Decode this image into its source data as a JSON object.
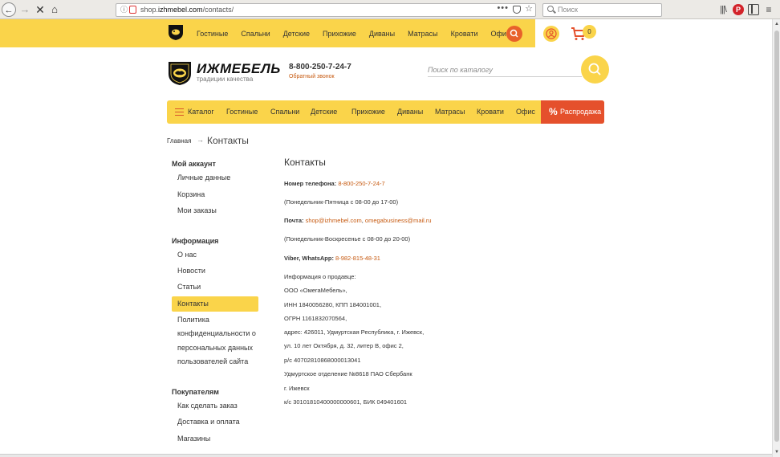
{
  "browser": {
    "url_prefix": "shop.",
    "url_domain": "izhmebel.com",
    "url_path": "/contacts/",
    "url_dots": "•••",
    "search_placeholder": "Поиск",
    "nav_back": "←",
    "nav_forward": "→",
    "nav_stop": "✕",
    "nav_home": "⌂",
    "info_glyph": "ⓘ",
    "star_glyph": "☆",
    "library_glyph": "|||\\",
    "pinterest_glyph": "P",
    "menu_glyph": "≡",
    "accent": "#e5502c"
  },
  "top_menu": [
    "Гостиные",
    "Спальни",
    "Детские",
    "Прихожие",
    "Диваны",
    "Матрасы",
    "Кровати",
    "Офис"
  ],
  "cart_count": "0",
  "brand": {
    "name": "ИЖМЕБЕЛЬ",
    "tagline": "традиции качества",
    "primary": "#fad44a"
  },
  "header": {
    "phone": "8-800-250-7-24-7",
    "callback": "Обратный звонок",
    "search_placeholder": "Поиск по каталогу"
  },
  "main_nav": {
    "catalog": "Каталог",
    "items": [
      "Гостиные",
      "Спальни",
      "Детские",
      "Прихожие",
      "Диваны",
      "Матрасы",
      "Кровати",
      "Офис"
    ],
    "sale_symbol": "%",
    "sale": "Распродажа"
  },
  "breadcrumb": {
    "home": "Главная",
    "separator": "→",
    "current": "Контакты"
  },
  "sidebar": {
    "account_heading": "Мой аккаунт",
    "account_links": [
      "Личные данные",
      "Корзина",
      "Мои заказы"
    ],
    "info_heading": "Информация",
    "info_links": [
      "О нас",
      "Новости",
      "Статьи",
      "Контакты"
    ],
    "privacy_lines": [
      "Политика",
      "конфиденциальности о",
      "персональных данных",
      "пользователей сайта"
    ],
    "buyers_heading": "Покупателям",
    "buyers_links": [
      "Как сделать заказ",
      "Доставка и оплата",
      "Магазины"
    ]
  },
  "content": {
    "title": "Контакты",
    "phone_label": "Номер телефона:",
    "phone_value": "8-800-250-7-24-7",
    "phone_hours": "(Понедельник-Пятница с 08-00 до 17-00)",
    "mail_label": "Почта:",
    "mail_1": "shop@izhmebel.com",
    "mail_sep": ",",
    "mail_2": "omegabusiness@mail.ru",
    "mail_hours": "(Понедельник-Воскресенье с 08-00 до 20-00)",
    "viber_label": "Viber, WhatsApp:",
    "viber_value": "8-982-815-48-31",
    "seller_lines": [
      "Информация о продавце:",
      "ООО «ОмегаМебель»,",
      "ИНН 1840056280, КПП 184001001,",
      "ОГРН 1161832070564,",
      "адрес: 426011, Удмуртская Республика, г. Ижевск,",
      "ул. 10 лет Октября, д. 32, литер В, офис 2,",
      "р/с 40702810868000013041",
      "Удмуртское отделение №8618 ПАО Сбербанк",
      "г. Ижевск",
      "к/с 30101810400000000601, БИК 049401601"
    ]
  }
}
